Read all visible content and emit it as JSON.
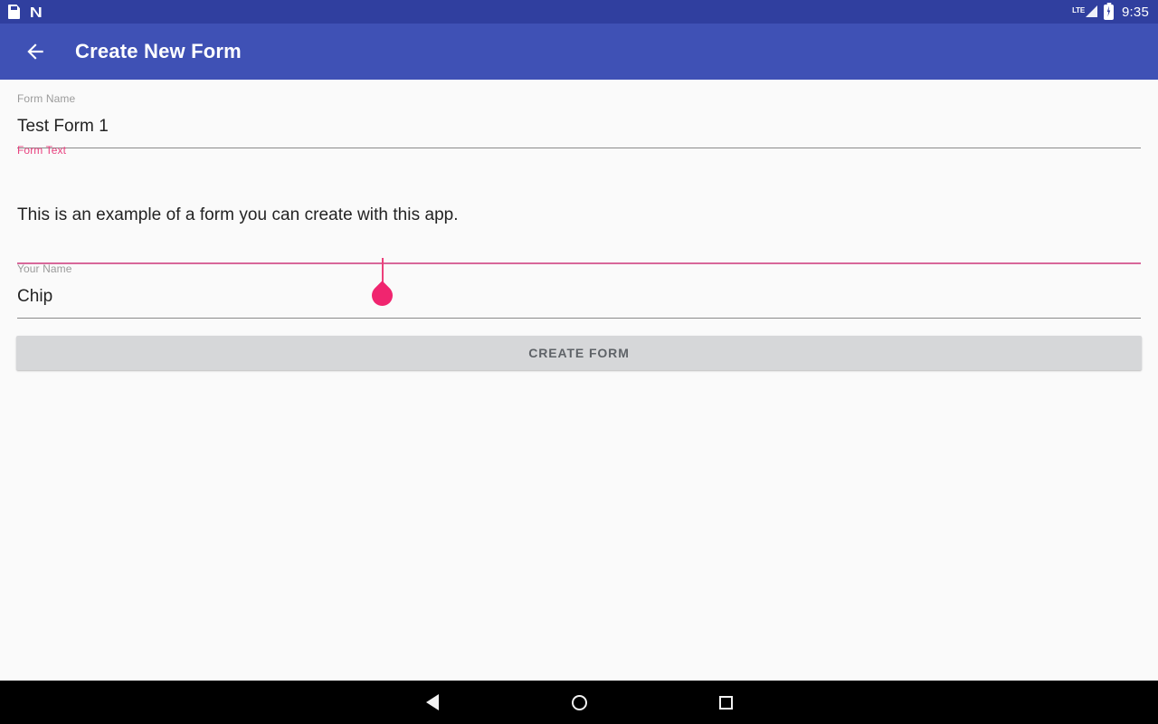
{
  "status_bar": {
    "icons_left": [
      "sd-card-icon",
      "nfc-icon"
    ],
    "lte_label": "LTE",
    "icons_right": [
      "signal-icon",
      "battery-charging-icon"
    ],
    "time": "9:35",
    "background_color": "#303f9f"
  },
  "app_bar": {
    "back_icon": "back-arrow-icon",
    "title": "Create New Form",
    "background_color": "#3f51b5"
  },
  "form": {
    "fields": [
      {
        "label": "Form Name",
        "value": "Test Form 1",
        "focused": false
      },
      {
        "label": "Form Text",
        "value": "This is an example of a form you can create with this app.",
        "focused": true
      },
      {
        "label": "Your Name",
        "value": "Chip",
        "focused": false
      }
    ],
    "accent_color": "#e8417f",
    "underline_focused_color": "#d8679a",
    "underline_color": "#8a8a8a",
    "caret_color": "#ec407a",
    "caret_handle_color": "#f0256f"
  },
  "submit_button": {
    "label": "CREATE FORM",
    "background_color": "#d6d7d9",
    "text_color": "#5f6368"
  },
  "nav_bar": {
    "buttons": [
      "back-triangle-icon",
      "home-circle-icon",
      "recents-square-icon"
    ],
    "background_color": "#000000"
  },
  "page_background": "#fafafa"
}
